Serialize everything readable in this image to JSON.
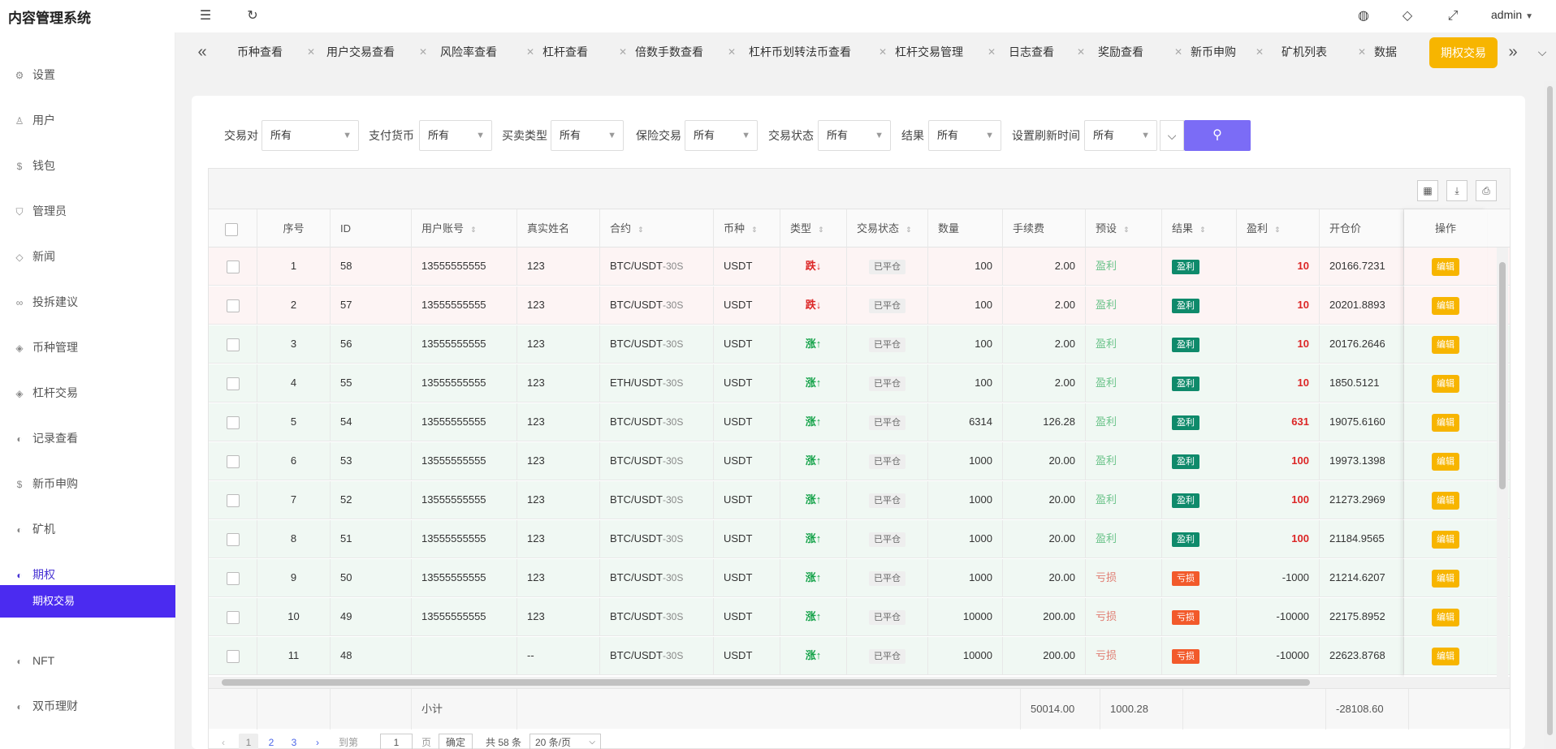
{
  "app": {
    "title": "内容管理系统",
    "user": "admin"
  },
  "sidebar": {
    "items": [
      {
        "label": "设置",
        "icon": "gear-icon",
        "glyph": "⚙"
      },
      {
        "label": "用户",
        "icon": "user-icon",
        "glyph": "♙"
      },
      {
        "label": "钱包",
        "icon": "dollar-icon",
        "glyph": "$"
      },
      {
        "label": "管理员",
        "icon": "shield-icon",
        "glyph": "⛉"
      },
      {
        "label": "新闻",
        "icon": "tag-icon",
        "glyph": "◇"
      },
      {
        "label": "投拆建议",
        "icon": "link-icon",
        "glyph": "∞"
      },
      {
        "label": "币种管理",
        "icon": "diamond-icon",
        "glyph": "◈"
      },
      {
        "label": "杠杆交易",
        "icon": "diamond-icon",
        "glyph": "◈"
      },
      {
        "label": "记录查看",
        "icon": "history-icon",
        "glyph": "◐"
      },
      {
        "label": "新币申购",
        "icon": "dollar-icon",
        "glyph": "$"
      },
      {
        "label": "矿机",
        "icon": "history-icon",
        "glyph": "◐"
      },
      {
        "label": "期权",
        "icon": "history-icon",
        "glyph": "◐"
      },
      {
        "label": "NFT",
        "icon": "history-icon",
        "glyph": "◐"
      },
      {
        "label": "双币理财",
        "icon": "history-icon",
        "glyph": "◐"
      }
    ],
    "sub_active": "期权交易"
  },
  "tabs": [
    "币种查看",
    "用户交易查看",
    "风险率查看",
    "杠杆查看",
    "倍数手数查看",
    "杠杆币划转法币查看",
    "杠杆交易管理",
    "日志查看",
    "奖励查看",
    "新币申购",
    "矿机列表",
    "数据",
    "期权交易"
  ],
  "filters": [
    {
      "label": "交易对",
      "value": "所有"
    },
    {
      "label": "支付货币",
      "value": "所有"
    },
    {
      "label": "买卖类型",
      "value": "所有"
    },
    {
      "label": "保险交易",
      "value": "所有"
    },
    {
      "label": "交易状态",
      "value": "所有"
    },
    {
      "label": "结果",
      "value": "所有"
    },
    {
      "label": "设置刷新时间",
      "value": "所有"
    }
  ],
  "table": {
    "headers": [
      "序号",
      "ID",
      "用户账号",
      "真实姓名",
      "合约",
      "币种",
      "类型",
      "交易状态",
      "数量",
      "手续费",
      "预设",
      "结果",
      "盈利",
      "开仓价"
    ],
    "op_header": "操作",
    "edit_label": "编辑",
    "rows": [
      {
        "no": "1",
        "id": "58",
        "account": "13555555555",
        "name": "123",
        "pair": "BTC/USDT",
        "period": "-30S",
        "coin": "USDT",
        "dir": "跌↓",
        "state": "已平仓",
        "qty": "100",
        "fee": "2.00",
        "preset": "盈利",
        "result": "盈利",
        "profit": "10",
        "open": "20166.7231"
      },
      {
        "no": "2",
        "id": "57",
        "account": "13555555555",
        "name": "123",
        "pair": "BTC/USDT",
        "period": "-30S",
        "coin": "USDT",
        "dir": "跌↓",
        "state": "已平仓",
        "qty": "100",
        "fee": "2.00",
        "preset": "盈利",
        "result": "盈利",
        "profit": "10",
        "open": "20201.8893"
      },
      {
        "no": "3",
        "id": "56",
        "account": "13555555555",
        "name": "123",
        "pair": "BTC/USDT",
        "period": "-30S",
        "coin": "USDT",
        "dir": "涨↑",
        "state": "已平仓",
        "qty": "100",
        "fee": "2.00",
        "preset": "盈利",
        "result": "盈利",
        "profit": "10",
        "open": "20176.2646"
      },
      {
        "no": "4",
        "id": "55",
        "account": "13555555555",
        "name": "123",
        "pair": "ETH/USDT",
        "period": "-30S",
        "coin": "USDT",
        "dir": "涨↑",
        "state": "已平仓",
        "qty": "100",
        "fee": "2.00",
        "preset": "盈利",
        "result": "盈利",
        "profit": "10",
        "open": "1850.5121"
      },
      {
        "no": "5",
        "id": "54",
        "account": "13555555555",
        "name": "123",
        "pair": "BTC/USDT",
        "period": "-30S",
        "coin": "USDT",
        "dir": "涨↑",
        "state": "已平仓",
        "qty": "6314",
        "fee": "126.28",
        "preset": "盈利",
        "result": "盈利",
        "profit": "631",
        "open": "19075.6160"
      },
      {
        "no": "6",
        "id": "53",
        "account": "13555555555",
        "name": "123",
        "pair": "BTC/USDT",
        "period": "-30S",
        "coin": "USDT",
        "dir": "涨↑",
        "state": "已平仓",
        "qty": "1000",
        "fee": "20.00",
        "preset": "盈利",
        "result": "盈利",
        "profit": "100",
        "open": "19973.1398"
      },
      {
        "no": "7",
        "id": "52",
        "account": "13555555555",
        "name": "123",
        "pair": "BTC/USDT",
        "period": "-30S",
        "coin": "USDT",
        "dir": "涨↑",
        "state": "已平仓",
        "qty": "1000",
        "fee": "20.00",
        "preset": "盈利",
        "result": "盈利",
        "profit": "100",
        "open": "21273.2969"
      },
      {
        "no": "8",
        "id": "51",
        "account": "13555555555",
        "name": "123",
        "pair": "BTC/USDT",
        "period": "-30S",
        "coin": "USDT",
        "dir": "涨↑",
        "state": "已平仓",
        "qty": "1000",
        "fee": "20.00",
        "preset": "盈利",
        "result": "盈利",
        "profit": "100",
        "open": "21184.9565"
      },
      {
        "no": "9",
        "id": "50",
        "account": "13555555555",
        "name": "123",
        "pair": "BTC/USDT",
        "period": "-30S",
        "coin": "USDT",
        "dir": "涨↑",
        "state": "已平仓",
        "qty": "1000",
        "fee": "20.00",
        "preset": "亏损",
        "result": "亏损",
        "profit": "-1000",
        "open": "21214.6207"
      },
      {
        "no": "10",
        "id": "49",
        "account": "13555555555",
        "name": "123",
        "pair": "BTC/USDT",
        "period": "-30S",
        "coin": "USDT",
        "dir": "涨↑",
        "state": "已平仓",
        "qty": "10000",
        "fee": "200.00",
        "preset": "亏损",
        "result": "亏损",
        "profit": "-10000",
        "open": "22175.8952"
      },
      {
        "no": "11",
        "id": "48",
        "account": "",
        "name": "--",
        "pair": "BTC/USDT",
        "period": "-30S",
        "coin": "USDT",
        "dir": "涨↑",
        "state": "已平仓",
        "qty": "10000",
        "fee": "200.00",
        "preset": "亏损",
        "result": "亏损",
        "profit": "-10000",
        "open": "22623.8768"
      }
    ],
    "summary": {
      "label": "小计",
      "qty": "50014.00",
      "fee": "1000.28",
      "profit": "-28108.60"
    }
  },
  "pager": {
    "pages": [
      "1",
      "2",
      "3"
    ],
    "goto": "到第",
    "goto_value": "1",
    "page_unit": "页",
    "confirm": "确定",
    "total": "共 58 条",
    "size": "20 条/页"
  },
  "colors": {
    "win_row": "#f0f8f3",
    "lose_row": "#fdf4f4",
    "win_tag": "#0f8a6b",
    "lose_tag": "#f25a2b",
    "accent": "#4b2bf0",
    "active_tab": "#f7b500"
  }
}
